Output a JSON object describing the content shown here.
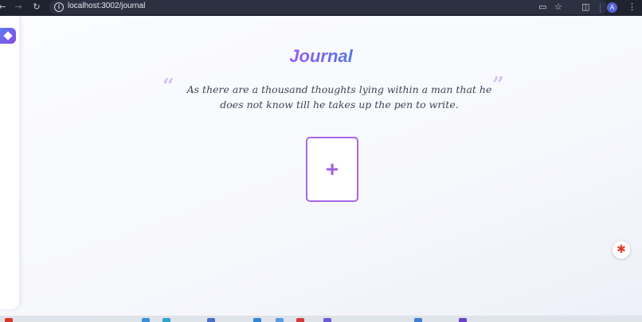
{
  "browser": {
    "url": "localhost:3002/journal",
    "profile_initial": "A",
    "icons": [
      "back-icon",
      "forward-icon",
      "reload-icon",
      "site-info-icon",
      "install-app-icon",
      "bookmark-star-icon",
      "extensions-icon",
      "menu-kebab-icon"
    ]
  },
  "page": {
    "title": "Journal",
    "quote": "As there are a thousand thoughts lying within a man that he does not know till he takes up the pen to write.",
    "quote_open_mark": "“",
    "quote_close_mark": "”",
    "add_label": "+"
  },
  "colors": {
    "accent_purple": "#a568e6",
    "accent_blue": "#4f78e8",
    "pdf_red": "#e03a2d"
  }
}
